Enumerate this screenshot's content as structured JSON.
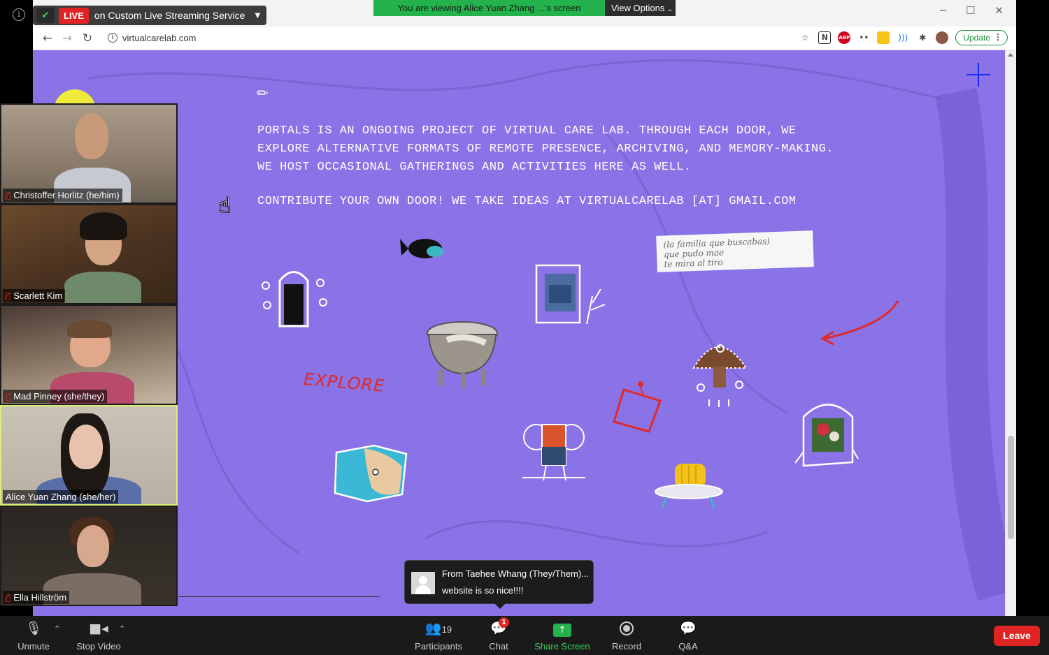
{
  "live": {
    "badge": "LIVE",
    "text": "on Custom Live Streaming Service"
  },
  "viewing": {
    "banner": "You are viewing Alice Yuan Zhang ...'s screen",
    "options": "View Options"
  },
  "browser": {
    "url": "virtualcarelab.com",
    "update_label": "Update"
  },
  "page": {
    "pencil": "✏",
    "intro_lines": [
      "PORTALS IS AN ONGOING PROJECT OF VIRTUAL CARE LAB. THROUGH EACH DOOR, WE",
      "EXPLORE ALTERNATIVE FORMATS OF REMOTE PRESENCE, ARCHIVING, AND MEMORY-MAKING.",
      "WE HOST OCCASIONAL GATHERINGS AND ACTIVITIES HERE AS WELL."
    ],
    "contribute": "CONTRIBUTE YOUR OWN DOOR! WE TAKE IDEAS AT VIRTUALCARELAB [AT] GMAIL.COM",
    "explore": "EXPLORE",
    "note_lines": [
      "(la familia que buscabas)",
      "que pudo mae",
      "te mira al tiro"
    ]
  },
  "participants": [
    {
      "name": "Christoffer Horlitz (he/him)",
      "muted": true
    },
    {
      "name": "Scarlett Kim",
      "muted": true
    },
    {
      "name": "Mad Pinney (she/they)",
      "muted": true
    },
    {
      "name": "Alice Yuan Zhang (she/her)",
      "muted": false,
      "active": true
    },
    {
      "name": "Ella Hillström",
      "muted": true
    }
  ],
  "chat_popup": {
    "from": "From Taehee Whang (They/Them)...",
    "message": "website is so nice!!!!"
  },
  "toolbar": {
    "unmute": "Unmute",
    "stop_video": "Stop Video",
    "participants": "Participants",
    "participants_count": "19",
    "chat": "Chat",
    "chat_badge": "1",
    "share_screen": "Share Screen",
    "record": "Record",
    "qa": "Q&A",
    "leave": "Leave"
  },
  "colors": {
    "page_bg": "#8a73e6",
    "live_red": "#e02424",
    "share_green": "#23b24b",
    "active_border": "#d9f070"
  }
}
